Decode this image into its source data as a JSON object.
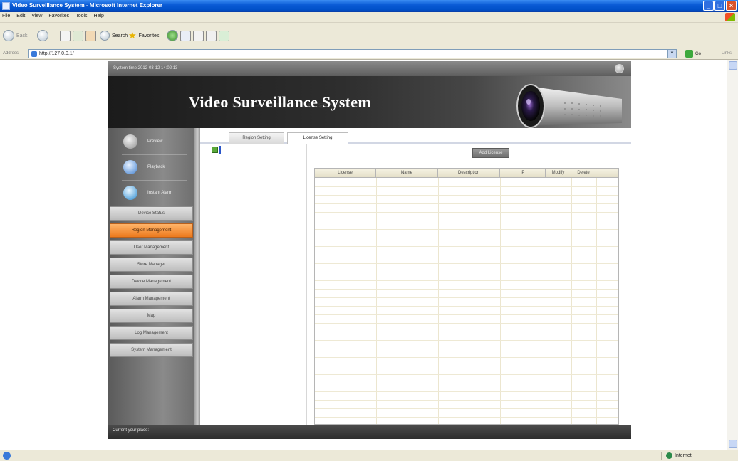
{
  "browser": {
    "window_title": "Video Surveillance System - Microsoft Internet Explorer",
    "menu": [
      "File",
      "Edit",
      "View",
      "Favorites",
      "Tools",
      "Help"
    ],
    "toolbar": {
      "back_label": "Back",
      "search_label": "Search",
      "favorites_label": "Favorites"
    },
    "address_label": "Address",
    "address_url": "http://127.0.0.1/",
    "go_label": "Go",
    "links_label": "Links",
    "status_zone": "Internet"
  },
  "app": {
    "system_time": "System time:2012-03-12 14:02:13",
    "banner_title": "Video Surveillance System",
    "sidebar_top": [
      {
        "label": "Preview",
        "icon": "camera-icon"
      },
      {
        "label": "Playback",
        "icon": "playback-icon"
      },
      {
        "label": "Instant Alarm",
        "icon": "alarm-icon"
      }
    ],
    "nav": [
      {
        "label": "Device Status",
        "active": false
      },
      {
        "label": "Region Management",
        "active": true
      },
      {
        "label": "User Management",
        "active": false
      },
      {
        "label": "Store Manager",
        "active": false
      },
      {
        "label": "Device Management",
        "active": false
      },
      {
        "label": "Alarm Management",
        "active": false
      },
      {
        "label": "Map",
        "active": false
      },
      {
        "label": "Log Management",
        "active": false
      },
      {
        "label": "System Management",
        "active": false
      }
    ],
    "tabs": [
      {
        "label": "Region Setting",
        "active": false
      },
      {
        "label": "License Setting",
        "active": true
      }
    ],
    "add_button": "Add License",
    "columns": [
      "License",
      "Name",
      "Description",
      "IP",
      "Modify",
      "Delete"
    ],
    "footer_position": "Current your place:"
  },
  "colors": {
    "active_nav": "#ec7a1e",
    "titlebar": "#0a5bd6"
  }
}
